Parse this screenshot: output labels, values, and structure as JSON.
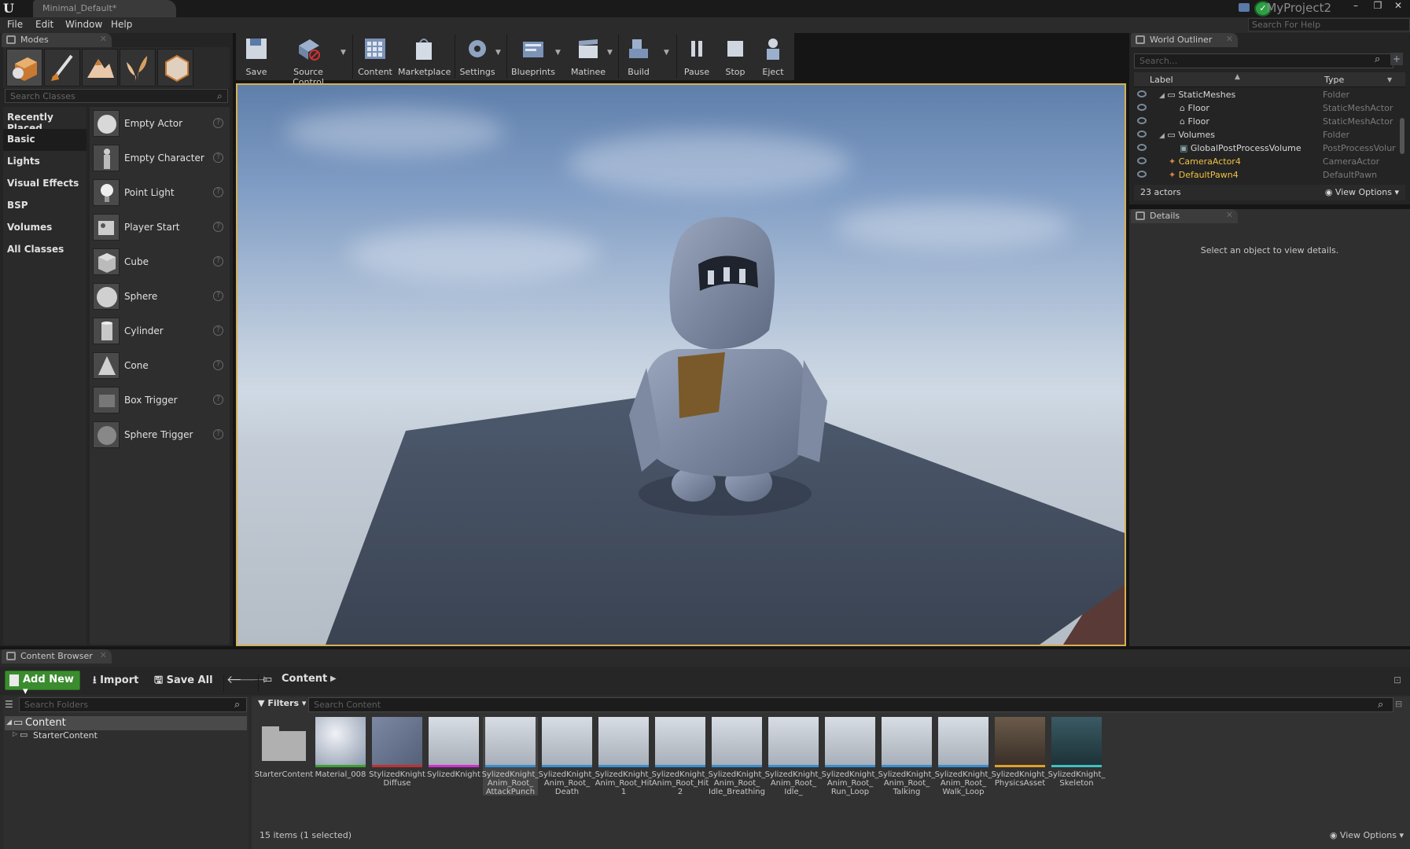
{
  "window": {
    "doc_tab": "Minimal_Default*",
    "project_name": "MyProject2",
    "help_search_placeholder": "Search For Help",
    "minimize": "–",
    "maximize": "❐",
    "close": "✕"
  },
  "menu": [
    "File",
    "Edit",
    "Window",
    "Help"
  ],
  "modes": {
    "tab_label": "Modes",
    "search_placeholder": "Search Classes",
    "categories": [
      "Recently Placed",
      "Basic",
      "Lights",
      "Visual Effects",
      "BSP",
      "Volumes",
      "All Classes"
    ],
    "selected_category": "Basic",
    "items": [
      "Empty Actor",
      "Empty Character",
      "Point Light",
      "Player Start",
      "Cube",
      "Sphere",
      "Cylinder",
      "Cone",
      "Box Trigger",
      "Sphere Trigger"
    ]
  },
  "toolbar": {
    "buttons": [
      "Save",
      "Source Control",
      "Content",
      "Marketplace",
      "Settings",
      "Blueprints",
      "Matinee",
      "Build",
      "Pause",
      "Stop",
      "Eject"
    ]
  },
  "outliner": {
    "tab_label": "World Outliner",
    "search_placeholder": "Search...",
    "col_label": "Label",
    "col_type": "Type",
    "rows": [
      {
        "label": "StaticMeshes",
        "type": "Folder"
      },
      {
        "label": "Floor",
        "type": "StaticMeshActor"
      },
      {
        "label": "Floor",
        "type": "StaticMeshActor"
      },
      {
        "label": "Volumes",
        "type": "Folder"
      },
      {
        "label": "GlobalPostProcessVolume",
        "type": "PostProcessVolur"
      },
      {
        "label": "CameraActor4",
        "type": "CameraActor"
      },
      {
        "label": "DefaultPawn4",
        "type": "DefaultPawn"
      }
    ],
    "actor_count": "23 actors",
    "view_options": "View Options"
  },
  "details": {
    "tab_label": "Details",
    "empty_text": "Select an object to view details."
  },
  "content_browser": {
    "tab_label": "Content Browser",
    "add_new": "Add New",
    "import": "Import",
    "save_all": "Save All",
    "path": "Content",
    "folder_search_placeholder": "Search Folders",
    "tree_root": "Content",
    "tree_child": "StarterContent",
    "filters": "Filters",
    "content_search_placeholder": "Search Content",
    "assets": [
      "StarterContent",
      "Material_008",
      "StylizedKnight Diffuse",
      "SylizedKnight",
      "SylizedKnight_ Anim_Root_ AttackPunch",
      "SylizedKnight_ Anim_Root_ Death",
      "SylizedKnight_ Anim_Root_Hit 1",
      "SylizedKnight_ Anim_Root_Hit 2",
      "SylizedKnight_ Anim_Root_ Idle_Breathing",
      "SylizedKnight_ Anim_Root_ Idle_",
      "SylizedKnight_ Anim_Root_ Run_Loop",
      "SylizedKnight_ Anim_Root_ Talking",
      "SylizedKnight_ Anim_Root_ Walk_Loop",
      "SylizedKnight_ PhysicsAsset",
      "SylizedKnight_ Skeleton"
    ],
    "items_count": "15 items (1 selected)",
    "view_options": "View Options"
  }
}
